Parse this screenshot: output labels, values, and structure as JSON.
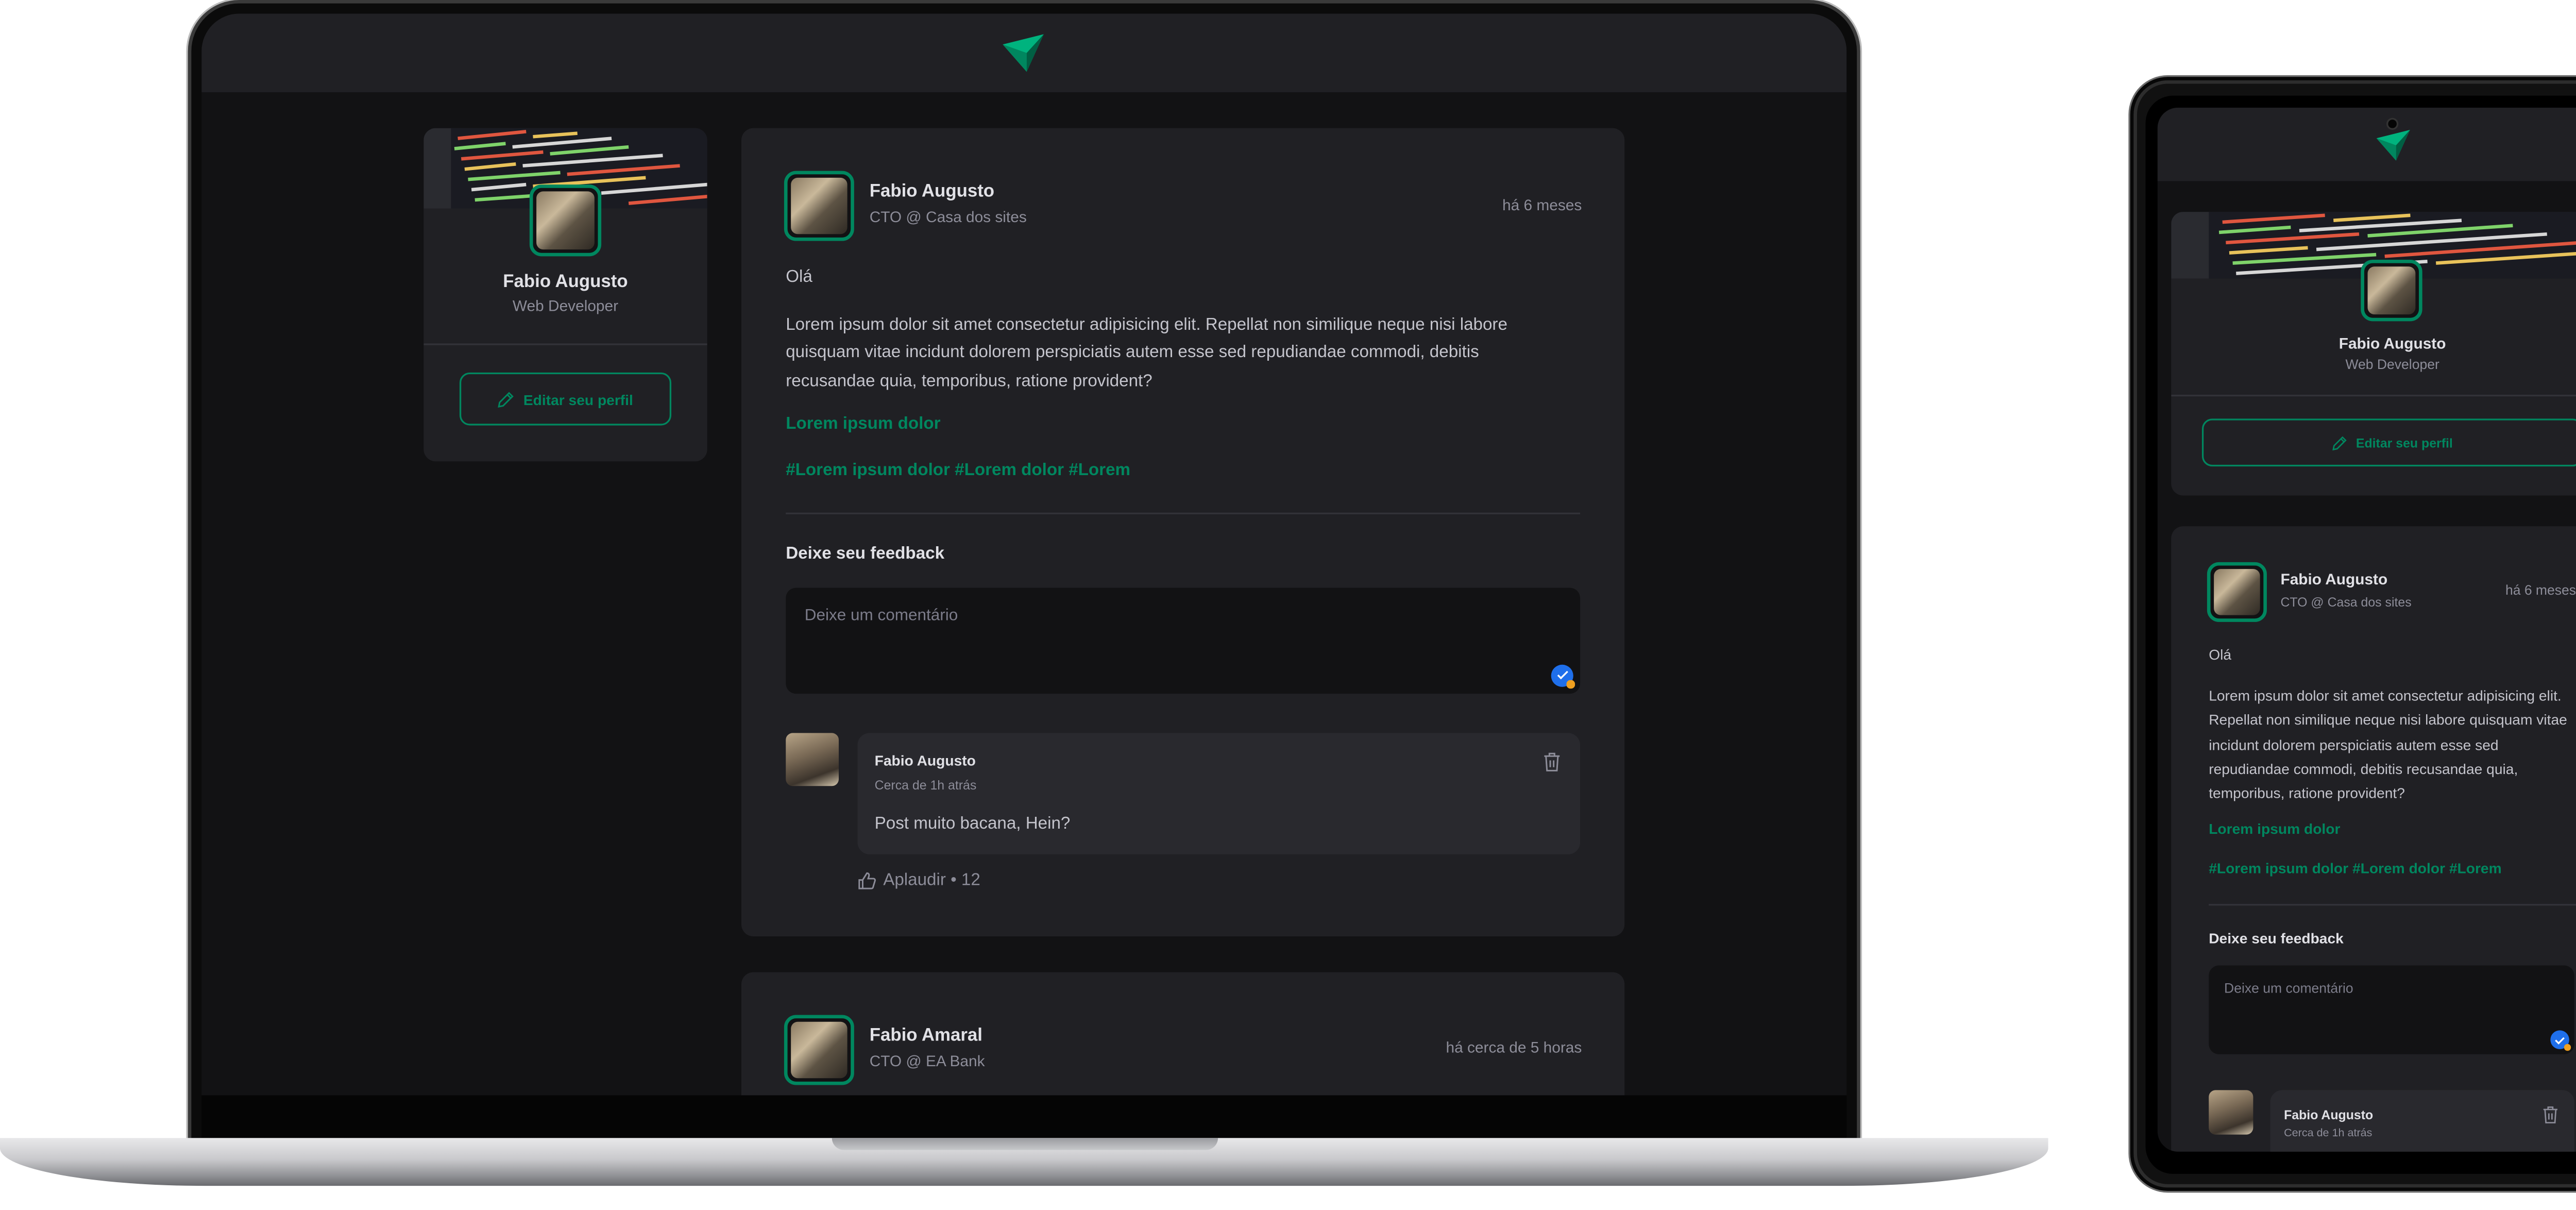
{
  "profile": {
    "name": "Fabio Augusto",
    "role": "Web Developer",
    "edit_label": "Editar seu perfil"
  },
  "post1": {
    "author": "Fabio Augusto",
    "author_role": "CTO @ Casa dos sites",
    "time": "há 6 meses",
    "greeting": "Olá",
    "body": "Lorem ipsum dolor sit amet consectetur adipisicing elit. Repellat non similique neque nisi labore quisquam vitae incidunt dolorem perspiciatis autem esse sed repudiandae commodi, debitis recusandae quia, temporibus, ratione provident?",
    "link": "Lorem ipsum dolor",
    "hashtags": "#Lorem ipsum dolor #Lorem dolor #Lorem",
    "feedback_title": "Deixe seu feedback",
    "comment_placeholder": "Deixe um comentário"
  },
  "comment": {
    "author": "Fabio Augusto",
    "time": "Cerca de 1h atrás",
    "text": "Post muito bacana, Hein?",
    "applaud": "Aplaudir • 12"
  },
  "post2": {
    "author": "Fabio Amaral",
    "author_role": "CTO @ EA Bank",
    "time": "há cerca de 5 horas"
  },
  "colors": {
    "brand_green": "#00875f",
    "background": "#121214",
    "card": "#202024"
  },
  "icons": [
    "logo-icon",
    "pencil-icon",
    "check-icon",
    "trash-icon",
    "thumbs-up-icon"
  ]
}
